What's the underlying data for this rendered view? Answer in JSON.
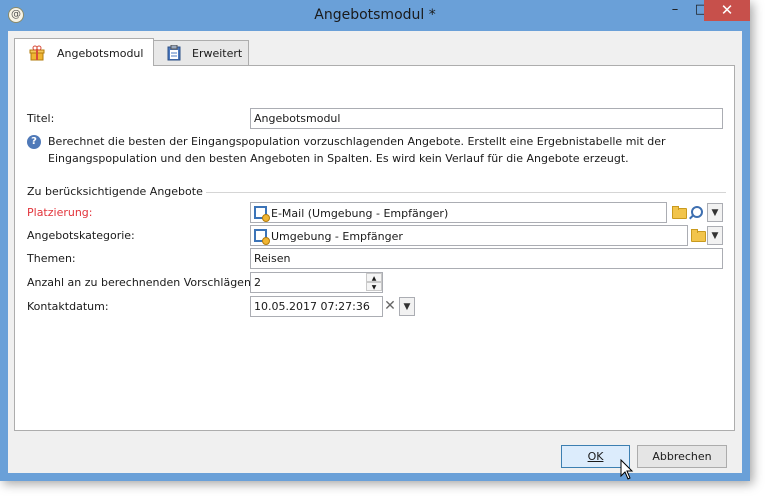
{
  "window": {
    "title": "Angebotsmodul *",
    "close_glyph": "✕",
    "minimize_glyph": "–",
    "maximize_glyph": "□"
  },
  "tabs": [
    {
      "label": "Angebotsmodul",
      "icon": "offer-gift-icon",
      "active": true
    },
    {
      "label": "Erweitert",
      "icon": "clipboard-icon",
      "active": false
    }
  ],
  "form": {
    "title_label": "Titel:",
    "title_value": "Angebotsmodul",
    "description": "Berechnet die besten der Eingangspopulation vorzuschlagenden Angebote. Erstellt eine Ergebnistabelle mit der Eingangspopulation und den besten Angeboten in Spalten. Es wird kein Verlauf für die Angebote erzeugt.",
    "group_title": "Zu berücksichtigende Angebote",
    "placement_label": "Platzierung:",
    "placement_value": "E-Mail (Umgebung - Empfänger)",
    "category_label": "Angebotskategorie:",
    "category_value": "Umgebung - Empfänger",
    "themes_label": "Themen:",
    "themes_value": "Reisen",
    "count_label": "Anzahl an zu berechnenden Vorschlägen:",
    "count_value": "2",
    "contact_label": "Kontaktdatum:",
    "contact_value": "10.05.2017 07:27:36"
  },
  "buttons": {
    "ok": "OK",
    "cancel": "Abbrechen"
  },
  "colors": {
    "titlebar": "#6aa0d8",
    "close": "#c7504b",
    "required_label": "#e2343b"
  }
}
